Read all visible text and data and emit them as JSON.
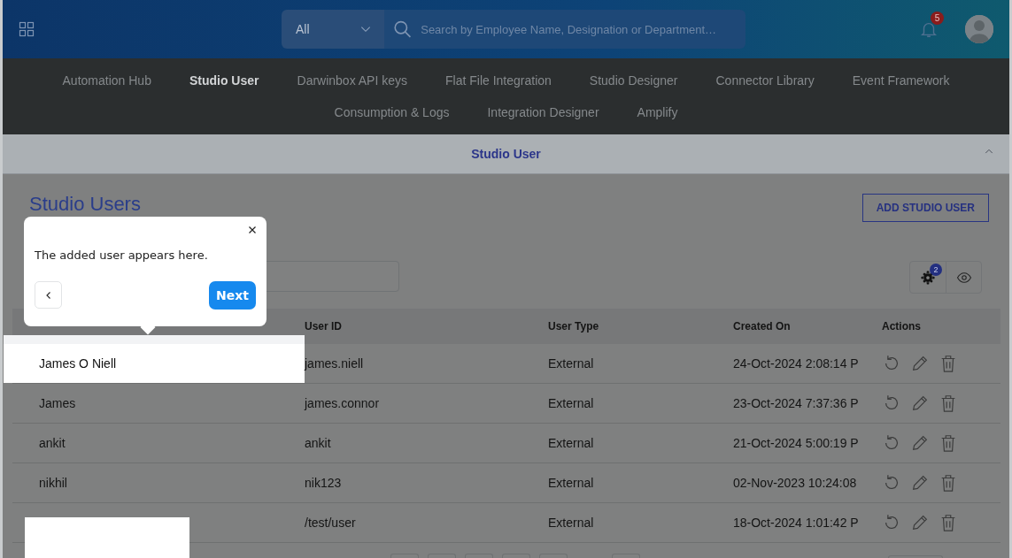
{
  "top_bar": {
    "scope_select": {
      "value": "All"
    },
    "search": {
      "placeholder": "Search by Employee Name, Designation or Department…"
    },
    "notifications": {
      "count": "5"
    }
  },
  "nav": {
    "items": [
      {
        "label": "Automation Hub",
        "selected": false
      },
      {
        "label": "Studio User",
        "selected": true
      },
      {
        "label": "Darwinbox API keys",
        "selected": false
      },
      {
        "label": "Flat File Integration",
        "selected": false
      },
      {
        "label": "Studio Designer",
        "selected": false
      },
      {
        "label": "Connector Library",
        "selected": false
      },
      {
        "label": "Event Framework",
        "selected": false
      },
      {
        "label": "Consumption & Logs",
        "selected": false
      },
      {
        "label": "Integration Designer",
        "selected": false
      },
      {
        "label": "Amplify",
        "selected": false
      }
    ]
  },
  "section_header": {
    "title": "Studio User",
    "expanded": true
  },
  "page": {
    "title": "Studio Users",
    "add_button": "ADD STUDIO USER",
    "settings_badge": "2"
  },
  "table": {
    "columns": [
      "User ID",
      "User Type",
      "Created On",
      "Actions"
    ],
    "rows": [
      {
        "name": "James O Niell",
        "user_id": "james.niell",
        "user_type": "External",
        "created_on": "24-Oct-2024 2:08:14 P",
        "highlighted": true
      },
      {
        "name": "James",
        "user_id": "james.connor",
        "user_type": "External",
        "created_on": "23-Oct-2024 7:37:36 P",
        "highlighted": false
      },
      {
        "name": "ankit",
        "user_id": "ankit",
        "user_type": "External",
        "created_on": "21-Oct-2024 5:00:19 P",
        "highlighted": false
      },
      {
        "name": "nikhil",
        "user_id": "nik123",
        "user_type": "External",
        "created_on": "02-Nov-2023 10:24:08",
        "highlighted": false
      },
      {
        "user_id": "/test/user",
        "user_type": "External",
        "created_on": "18-Oct-2024 1:01:42 P",
        "highlighted": false
      }
    ]
  },
  "tour": {
    "text": "The added user appears here.",
    "next": "Next"
  }
}
